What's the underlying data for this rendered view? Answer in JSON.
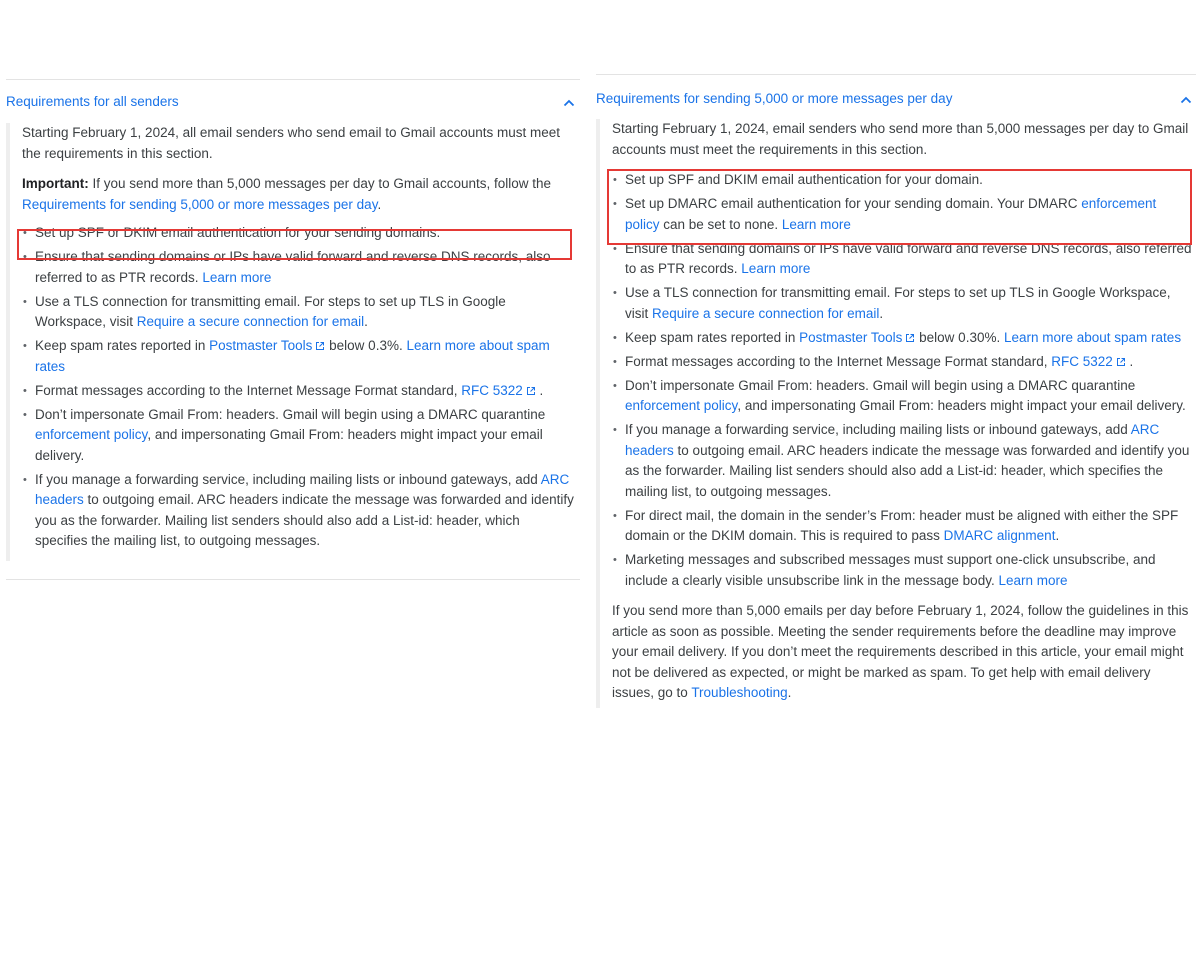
{
  "left": {
    "title": "Requirements for all senders",
    "intro": "Starting February 1, 2024, all email senders who send email to Gmail accounts must meet the requirements in this section.",
    "important_label": "Important:",
    "important_text": " If you send more than 5,000 messages per day to Gmail accounts, follow the ",
    "important_link": "Requirements for sending 5,000 or more messages per day",
    "important_end": ".",
    "b1": "Set up SPF or DKIM email authentication for your sending domains.",
    "b2_text": "Ensure that sending domains or IPs have valid forward and reverse DNS records, also referred to as PTR records. ",
    "b2_link": "Learn more",
    "b3_text": "Use a TLS connection for transmitting email. For steps to set up TLS in Google Workspace, visit ",
    "b3_link": "Require a secure connection for email",
    "b3_end": ".",
    "b4_text": "Keep spam rates reported in ",
    "b4_link1": "Postmaster Tools",
    "b4_mid": " below 0.3%. ",
    "b4_link2": "Learn more about spam rates",
    "b5_text": "Format messages according to the Internet Message Format standard, ",
    "b5_link": "RFC 5322",
    "b5_end": " .",
    "b6_text": "Don’t impersonate Gmail From: headers. Gmail will begin using a DMARC quarantine ",
    "b6_link": "enforcement policy",
    "b6_end": ", and impersonating Gmail From: headers might impact your email delivery.",
    "b7_text": "If you manage a forwarding service, including mailing lists or inbound gateways, add ",
    "b7_link": "ARC headers",
    "b7_end": " to outgoing email. ARC headers indicate the message was forwarded and identify you as the forwarder. Mailing list senders should also add a List-id: header, which specifies the mailing list, to outgoing messages."
  },
  "right": {
    "title": "Requirements for sending 5,000 or more messages per day",
    "intro": "Starting February 1, 2024, email senders who send more than 5,000 messages per day to Gmail accounts must meet the requirements in this section.",
    "b1": "Set up SPF and DKIM email authentication for your domain.",
    "b2_text": "Set up DMARC email authentication for your sending domain. Your DMARC ",
    "b2_link1": "enforcement policy",
    "b2_mid": " can be set to none. ",
    "b2_link2": "Learn more",
    "b3_text": "Ensure that sending domains or IPs have valid forward and reverse DNS records, also referred to as PTR records. ",
    "b3_link": "Learn more",
    "b4_text": "Use a TLS connection for transmitting email. For steps to set up TLS in Google Workspace, visit ",
    "b4_link": "Require a secure connection for email",
    "b4_end": ".",
    "b5_text": "Keep spam rates reported in ",
    "b5_link1": "Postmaster Tools",
    "b5_mid": " below 0.30%. ",
    "b5_link2": "Learn more about spam rates",
    "b6_text": "Format messages according to the Internet Message Format standard, ",
    "b6_link": "RFC 5322",
    "b6_end": " .",
    "b7_text": "Don’t impersonate Gmail From: headers. Gmail will begin using a DMARC quarantine ",
    "b7_link": "enforcement policy",
    "b7_end": ", and impersonating Gmail From: headers might impact your email delivery.",
    "b8_text": "If you manage a forwarding service, including mailing lists or inbound gateways, add ",
    "b8_link": "ARC headers",
    "b8_end": " to outgoing email. ARC headers indicate the message was forwarded and identify you as the forwarder. Mailing list senders should also add a List-id: header, which specifies the mailing list, to outgoing messages.",
    "b9_text": "For direct mail, the domain in the sender’s From: header must be aligned with either the SPF domain or the DKIM domain. This is required to pass ",
    "b9_link": "DMARC alignment",
    "b9_end": ".",
    "b10_text": "Marketing messages and subscribed messages must support one-click unsubscribe, and include a clearly visible unsubscribe link in the message body. ",
    "b10_link": "Learn more",
    "outro_text": "If you send more than 5,000 emails per day before February 1, 2024, follow the guidelines in this article as soon as possible. Meeting the sender requirements before the deadline may improve your email delivery. If you don’t meet the requirements described in this article, your email might not be delivered as expected, or might be marked as spam. To get help with email delivery issues, go to ",
    "outro_link": "Troubleshooting",
    "outro_end": "."
  },
  "icons": {
    "collapse": "chevron-up-icon",
    "external": "external-link-icon"
  },
  "colors": {
    "link": "#1a73e8",
    "highlight": "#e53935",
    "text": "#3c4043"
  }
}
